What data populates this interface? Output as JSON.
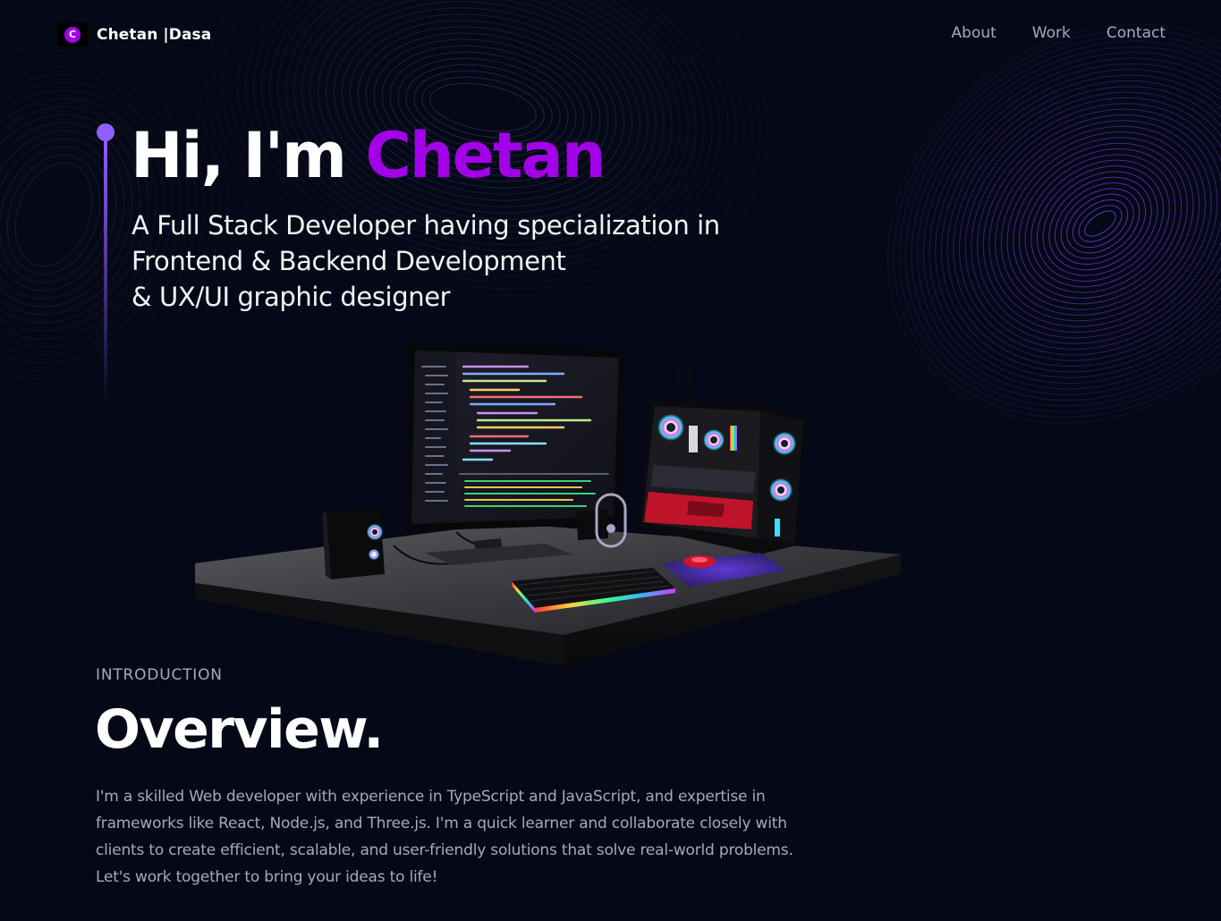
{
  "nav": {
    "logo_letter": "C",
    "logo_text": "Chetan |Dasa",
    "links": [
      "About",
      "Work",
      "Contact"
    ]
  },
  "hero": {
    "greeting": "Hi, I'm ",
    "name": "Chetan",
    "subtitle_lines": [
      "A Full Stack Developer having specialization in",
      "Frontend & Backend Development",
      "& UX/UI graphic designer"
    ]
  },
  "overview": {
    "label": "INTRODUCTION",
    "title": "Overview.",
    "text": "I'm a skilled Web developer with experience in TypeScript and JavaScript, and expertise in frameworks like React, Node.js, and Three.js. I'm a quick learner and collaborate closely with clients to create efficient, scalable, and user-friendly solutions that solve real-world problems. Let's work together to bring your ideas to life!"
  },
  "colors": {
    "background": "#050816",
    "accent_purple": "#a200e8",
    "line_purple": "#915eff",
    "secondary_text": "#aaa6c3"
  },
  "icons": {
    "logo": "logo-c-icon",
    "scroll": "scroll-indicator-icon",
    "scene": "computer-desk-3d"
  }
}
